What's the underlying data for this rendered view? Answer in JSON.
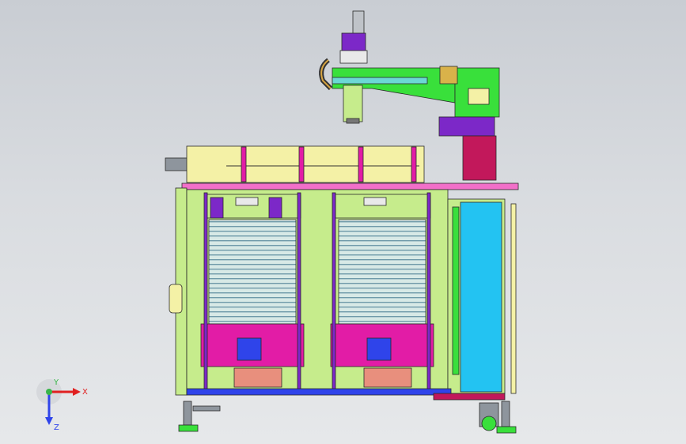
{
  "triad": {
    "x_label": "X",
    "y_label": "Y",
    "z_label": "Z"
  },
  "colors": {
    "light_green": "#c6ec8c",
    "bright_green": "#39e03b",
    "yellow_panel": "#f4f1a6",
    "magenta": "#e21ca6",
    "pink": "#f26fc9",
    "purple": "#7c28c8",
    "blue": "#2f44ea",
    "cyan": "#23c3f2",
    "crimson": "#c2185b",
    "gray": "#8e959d",
    "slot_lines": "#9fbfcf",
    "outline": "#2a2a2a"
  }
}
